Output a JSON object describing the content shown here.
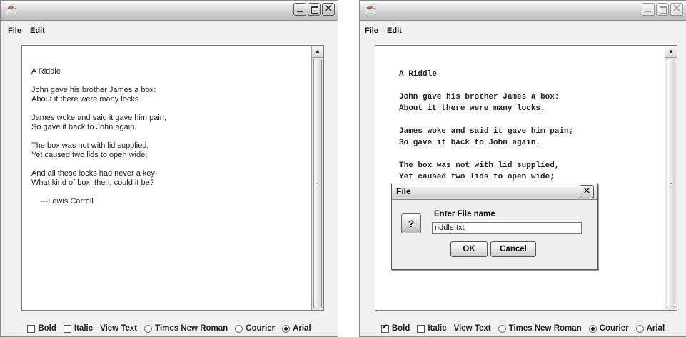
{
  "windows": [
    {
      "menu": [
        "File",
        "Edit"
      ],
      "document": "A Riddle\n\nJohn gave his brother James a box:\nAbout it there were many locks.\n\nJames woke and said it gave him pain;\nSo gave it back to John again.\n\nThe box was not with lid supplied,\nYet caused two lids to open wide;\n\nAnd all these locks had never a key-\nWhat kind of box, then, could it be?\n\n    ---Lewis Carroll",
      "toolbar": {
        "bold": "Bold",
        "bold_checked": false,
        "italic": "Italic",
        "italic_checked": false,
        "view_text": "View Text",
        "fonts": [
          "Times New Roman",
          "Courier",
          "Arial"
        ],
        "selected_font": "Arial"
      }
    },
    {
      "menu": [
        "File",
        "Edit"
      ],
      "document": "A Riddle\n\nJohn gave his brother James a box:\nAbout it there were many locks.\n\nJames woke and said it gave him pain;\nSo gave it back to John again.\n\nThe box was not with lid supplied,\nYet caused two lids to open wide;",
      "toolbar": {
        "bold": "Bold",
        "bold_checked": true,
        "italic": "Italic",
        "italic_checked": false,
        "view_text": "View Text",
        "fonts": [
          "Times New Roman",
          "Courier",
          "Arial"
        ],
        "selected_font": "Courier"
      },
      "dialog": {
        "title": "File",
        "icon": "question-icon",
        "prompt": "Enter File name",
        "value": "riddle.txt",
        "ok": "OK",
        "cancel": "Cancel"
      }
    }
  ]
}
